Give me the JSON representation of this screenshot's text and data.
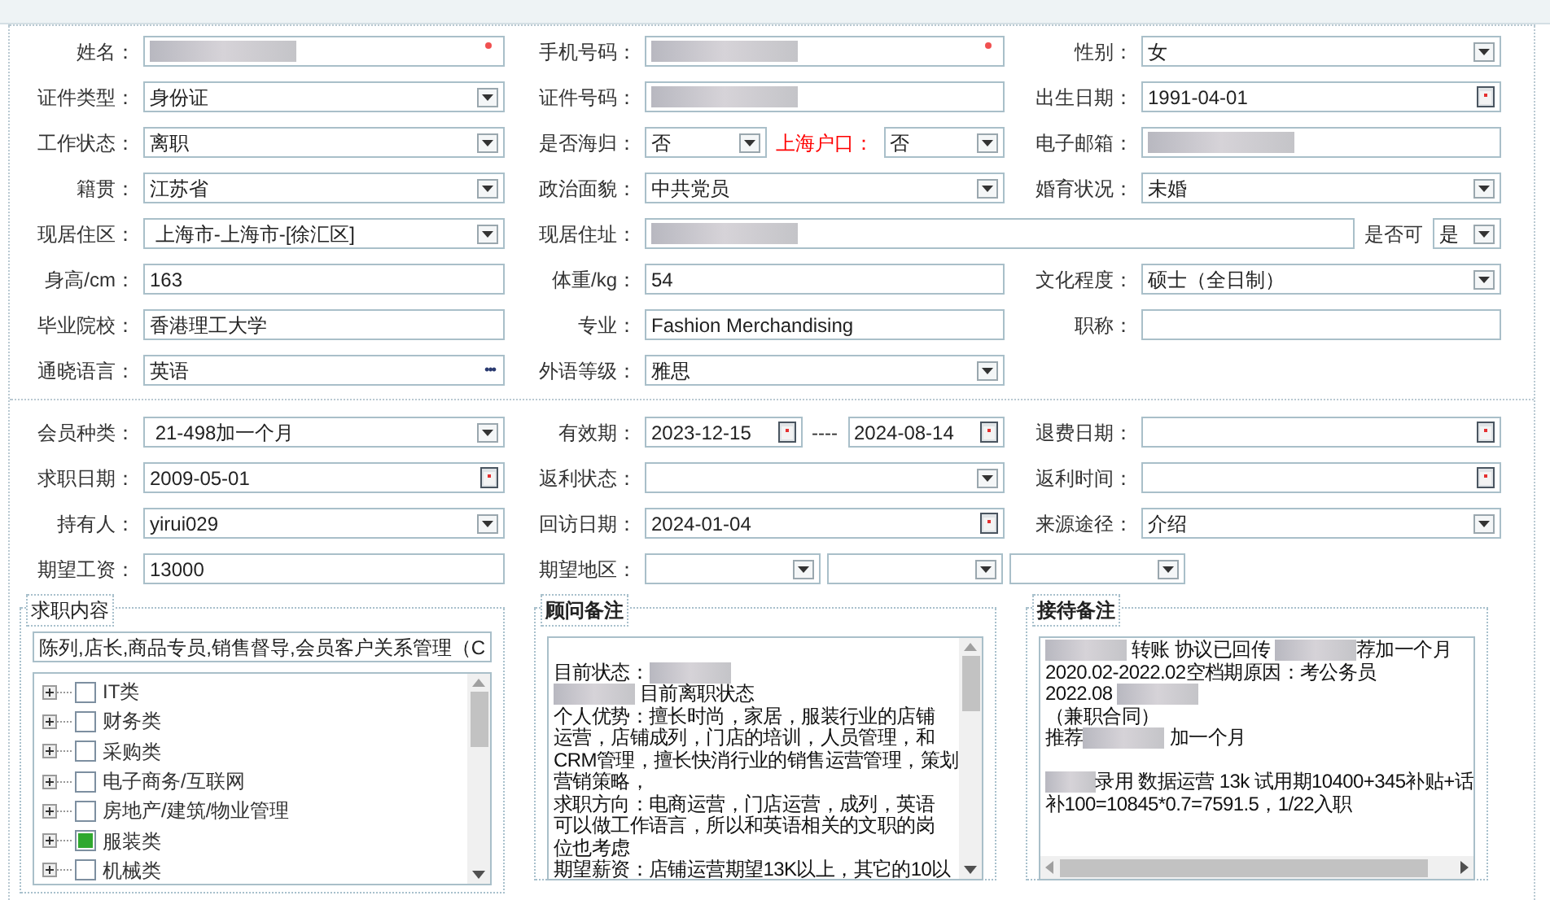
{
  "personal": {
    "rows": [
      [
        {
          "kind": "normal",
          "label": "姓名：",
          "controls": [
            {
              "kind": "text",
              "required": true,
              "redacted": true
            }
          ]
        },
        {
          "kind": "normal",
          "label": "手机号码：",
          "controls": [
            {
              "kind": "text",
              "required": true,
              "redacted": true
            }
          ]
        },
        {
          "kind": "normal",
          "label": "性别：",
          "controls": [
            {
              "kind": "select",
              "value": "女"
            }
          ]
        }
      ],
      [
        {
          "kind": "normal",
          "label": "证件类型：",
          "controls": [
            {
              "kind": "select",
              "value": "身份证"
            }
          ]
        },
        {
          "kind": "normal",
          "label": "证件号码：",
          "controls": [
            {
              "kind": "text",
              "redacted": true
            }
          ]
        },
        {
          "kind": "normal",
          "label": "出生日期：",
          "controls": [
            {
              "kind": "date",
              "value": "1991-04-01"
            }
          ]
        }
      ],
      [
        {
          "kind": "normal",
          "label": "工作状态：",
          "controls": [
            {
              "kind": "select",
              "value": "离职"
            }
          ]
        },
        {
          "kind": "normal",
          "label": "是否海归：",
          "controls": [
            {
              "kind": "select",
              "value": "否"
            },
            {
              "kind": "label",
              "text": "上海户口：",
              "highlight": true
            },
            {
              "kind": "select",
              "value": "否"
            }
          ]
        },
        {
          "kind": "normal",
          "label": "电子邮箱：",
          "controls": [
            {
              "kind": "text",
              "redacted": true
            }
          ]
        }
      ],
      [
        {
          "kind": "normal",
          "label": "籍贯：",
          "controls": [
            {
              "kind": "select",
              "value": "江苏省"
            }
          ]
        },
        {
          "kind": "normal",
          "label": "政治面貌：",
          "controls": [
            {
              "kind": "select",
              "value": "中共党员"
            }
          ]
        },
        {
          "kind": "normal",
          "label": "婚育状况：",
          "controls": [
            {
              "kind": "select",
              "value": "未婚"
            }
          ]
        }
      ],
      [
        {
          "kind": "normal",
          "label": "现居住区：",
          "controls": [
            {
              "kind": "select",
              "value": " 上海市-上海市-[徐汇区]"
            }
          ]
        },
        {
          "kind": "wide",
          "label": "现居住址：",
          "controls": [
            {
              "kind": "text",
              "redacted": true
            },
            {
              "kind": "label",
              "text": "是否可",
              "highlight": false
            },
            {
              "kind": "select",
              "value": "是"
            }
          ]
        }
      ],
      [
        {
          "kind": "normal",
          "label": "身高/cm：",
          "controls": [
            {
              "kind": "text",
              "value": "163"
            }
          ]
        },
        {
          "kind": "normal",
          "label": "体重/kg：",
          "controls": [
            {
              "kind": "text",
              "value": "54"
            }
          ]
        },
        {
          "kind": "normal",
          "label": "文化程度：",
          "controls": [
            {
              "kind": "select",
              "value": "硕士（全日制）"
            }
          ]
        }
      ],
      [
        {
          "kind": "normal",
          "label": "毕业院校：",
          "controls": [
            {
              "kind": "text",
              "value": "香港理工大学"
            }
          ]
        },
        {
          "kind": "normal",
          "label": "专业：",
          "controls": [
            {
              "kind": "text",
              "value": "Fashion Merchandising"
            }
          ]
        },
        {
          "kind": "normal",
          "label": "职称：",
          "controls": [
            {
              "kind": "text"
            }
          ]
        }
      ],
      [
        {
          "kind": "normal",
          "label": "通晓语言：",
          "controls": [
            {
              "kind": "lookup",
              "value": "英语",
              "button": "•••"
            }
          ]
        },
        {
          "kind": "normal",
          "label": "外语等级：",
          "controls": [
            {
              "kind": "select",
              "value": "雅思"
            }
          ]
        }
      ]
    ]
  },
  "membership": {
    "rows": [
      [
        {
          "kind": "normal",
          "label": "会员种类：",
          "controls": [
            {
              "kind": "select",
              "value": " 21-498加一个月"
            }
          ]
        },
        {
          "kind": "normal",
          "label": "有效期：",
          "controls": [
            {
              "kind": "date",
              "value": "2023-12-15"
            },
            {
              "kind": "label",
              "text": "----",
              "highlight": false
            },
            {
              "kind": "date",
              "value": "2024-08-14"
            }
          ]
        },
        {
          "kind": "normal",
          "label": "退费日期：",
          "controls": [
            {
              "kind": "date"
            }
          ]
        }
      ],
      [
        {
          "kind": "normal",
          "label": "求职日期：",
          "controls": [
            {
              "kind": "date",
              "value": "2009-05-01"
            }
          ]
        },
        {
          "kind": "normal",
          "label": "返利状态：",
          "controls": [
            {
              "kind": "select"
            }
          ]
        },
        {
          "kind": "normal",
          "label": "返利时间：",
          "controls": [
            {
              "kind": "date"
            }
          ]
        }
      ],
      [
        {
          "kind": "normal",
          "label": "持有人：",
          "controls": [
            {
              "kind": "select",
              "value": "yirui029"
            }
          ]
        },
        {
          "kind": "normal",
          "label": "回访日期：",
          "controls": [
            {
              "kind": "date",
              "value": "2024-01-04"
            }
          ]
        },
        {
          "kind": "normal",
          "label": "来源途径：",
          "controls": [
            {
              "kind": "select",
              "value": "介绍"
            }
          ]
        }
      ],
      [
        {
          "kind": "normal",
          "label": "期望工资：",
          "controls": [
            {
              "kind": "text",
              "value": "13000"
            }
          ]
        },
        {
          "kind": "wide",
          "label": "期望地区：",
          "controls": [
            {
              "kind": "select"
            },
            {
              "kind": "select"
            },
            {
              "kind": "select"
            }
          ]
        }
      ]
    ]
  },
  "job_content": {
    "title": "求职内容",
    "summary": "陈列,店长,商品专员,销售督导,会员客户关系管理（C",
    "items": [
      {
        "label": "IT类",
        "expanded": false,
        "checked": false
      },
      {
        "label": "财务类",
        "expanded": false,
        "checked": false
      },
      {
        "label": "采购类",
        "expanded": false,
        "checked": false
      },
      {
        "label": "电子商务/互联网",
        "expanded": false,
        "checked": false
      },
      {
        "label": "房地产/建筑/物业管理",
        "expanded": false,
        "checked": false
      },
      {
        "label": "服装类",
        "expanded": false,
        "checked": true
      },
      {
        "label": "机械类",
        "expanded": false,
        "checked": false
      }
    ]
  },
  "notes": [
    {
      "title": "顾问备注",
      "kind": "vertical",
      "lines": [
        {
          "blank_before": true,
          "parts": [
            {
              "kind": "text",
              "text": "目前状态："
            },
            {
              "kind": "redacted"
            }
          ]
        },
        {
          "parts": [
            {
              "kind": "redacted"
            },
            {
              "kind": "text",
              "text": " 目前离职状态"
            }
          ]
        },
        {
          "parts": [
            {
              "kind": "text",
              "text": "个人优势：擅长时尚，家居，服装行业的店铺"
            }
          ]
        },
        {
          "parts": [
            {
              "kind": "text",
              "text": "运营，店铺成列，门店的培训，人员管理，和"
            }
          ]
        },
        {
          "parts": [
            {
              "kind": "text",
              "text": "CRM管理，擅长快消行业的销售运营管理，策划"
            }
          ]
        },
        {
          "parts": [
            {
              "kind": "text",
              "text": "营销策略，"
            }
          ]
        },
        {
          "parts": [
            {
              "kind": "text",
              "text": "求职方向：电商运营，门店运营，成列，英语"
            }
          ]
        },
        {
          "parts": [
            {
              "kind": "text",
              "text": "可以做工作语言，所以和英语相关的文职的岗"
            }
          ]
        },
        {
          "parts": [
            {
              "kind": "text",
              "text": "位也考虑"
            }
          ]
        },
        {
          "parts": [
            {
              "kind": "text",
              "text": "期望薪资：店铺运营期望13K以上，其它的10以"
            }
          ]
        }
      ]
    },
    {
      "title": "接待备注",
      "kind": "horizontal",
      "lines": [
        {
          "parts": [
            {
              "kind": "redacted"
            },
            {
              "kind": "text",
              "text": " 转账 协议已回传 "
            },
            {
              "kind": "redacted"
            },
            {
              "kind": "text",
              "text": "荐加一个月"
            }
          ]
        },
        {
          "parts": [
            {
              "kind": "text",
              "text": "2020.02-2022.02空档期原因：考公务员"
            }
          ]
        },
        {
          "parts": [
            {
              "kind": "text",
              "text": "2022.08 "
            },
            {
              "kind": "redacted"
            }
          ]
        },
        {
          "parts": [
            {
              "kind": "text",
              "text": "（兼职合同）"
            }
          ]
        },
        {
          "parts": [
            {
              "kind": "text",
              "text": "推荐"
            },
            {
              "kind": "redacted"
            },
            {
              "kind": "text",
              "text": " 加一个月"
            }
          ]
        },
        {
          "blank_before": true,
          "parts": [
            {
              "kind": "redacted"
            },
            {
              "kind": "text",
              "text": "录用 数据运营 13k 试用期10400+345补贴+话"
            }
          ]
        },
        {
          "parts": [
            {
              "kind": "text",
              "text": "补100=10845*0.7=7591.5，1/22入职"
            }
          ]
        }
      ]
    }
  ]
}
